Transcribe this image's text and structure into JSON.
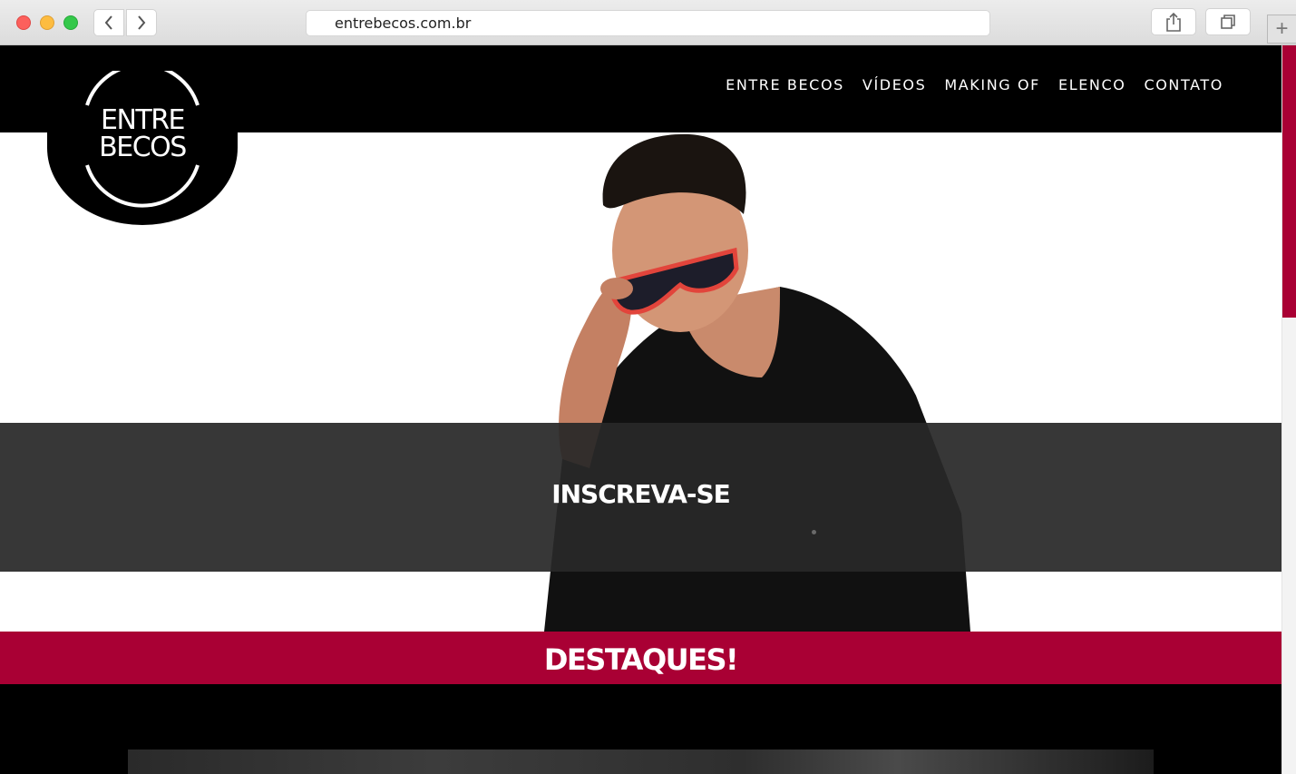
{
  "browser": {
    "url": "entrebecos.com.br",
    "new_tab_symbol": "+"
  },
  "site": {
    "logo": {
      "line1": "ENTRE",
      "line2": "BECOS"
    },
    "nav": [
      {
        "label": "ENTRE BECOS"
      },
      {
        "label": "VÍDEOS"
      },
      {
        "label": "MAKING OF"
      },
      {
        "label": "ELENCO"
      },
      {
        "label": "CONTATO"
      }
    ],
    "hero": {
      "cta": "INSCREVA-SE"
    },
    "section": {
      "title": "DESTAQUES!"
    }
  },
  "colors": {
    "accent": "#a90034",
    "header_bg": "#000000",
    "band_bg": "#282828"
  },
  "icons": [
    "back-chevron-icon",
    "forward-chevron-icon",
    "share-icon",
    "tabs-icon",
    "plus-icon"
  ]
}
